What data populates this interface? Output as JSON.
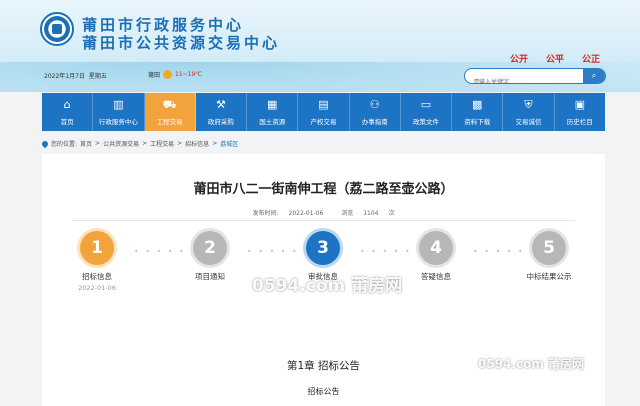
{
  "header": {
    "title_line1": "莆田市行政服务中心",
    "title_line2": "莆田市公共资源交易中心",
    "slogans": [
      "公开",
      "公平",
      "公正"
    ],
    "date": "2022年1月7日",
    "weekday": "星期五",
    "weather_city": "莆田",
    "weather_temp": "11~19℃",
    "search_placeholder": "请输入关键字",
    "colors": {
      "brand_blue": "#1d73c4",
      "accent_orange": "#f2a33c",
      "slogan_red": "#d9261c"
    }
  },
  "nav": {
    "items": [
      {
        "label": "首页",
        "icon": "home-icon",
        "glyph": "⌂"
      },
      {
        "label": "行政服务中心",
        "icon": "building-icon",
        "glyph": "▥"
      },
      {
        "label": "工程交易",
        "icon": "cart-icon",
        "glyph": "⛟"
      },
      {
        "label": "政府采购",
        "icon": "gavel-icon",
        "glyph": "⚒"
      },
      {
        "label": "国土资源",
        "icon": "land-icon",
        "glyph": "▦"
      },
      {
        "label": "产权交易",
        "icon": "document-icon",
        "glyph": "▤"
      },
      {
        "label": "办事指南",
        "icon": "people-icon",
        "glyph": "⚇"
      },
      {
        "label": "政策文件",
        "icon": "file-icon",
        "glyph": "▭"
      },
      {
        "label": "资料下载",
        "icon": "grid-icon",
        "glyph": "▩"
      },
      {
        "label": "交易诚信",
        "icon": "shield-icon",
        "glyph": "⛨"
      },
      {
        "label": "历史栏目",
        "icon": "history-icon",
        "glyph": "▣"
      }
    ],
    "active_index": 2
  },
  "breadcrumb": {
    "prefix": "您的位置:",
    "items": [
      "首页",
      "公共资源交易",
      "工程交易",
      "招标信息"
    ],
    "current": "荔城区"
  },
  "article": {
    "title": "莆田市八二一街南伸工程（荔二路至壶公路）",
    "publish_label": "发布时间:",
    "publish_date": "2022-01-06",
    "views_label": "浏览",
    "views": "1104",
    "views_unit": "次",
    "chapter": "第1章  招标公告",
    "subheading": "招标公告"
  },
  "steps": [
    {
      "num": "1",
      "label": "招标信息",
      "date": "2022-01-06",
      "state": "orange"
    },
    {
      "num": "2",
      "label": "项目通知",
      "date": "",
      "state": "gray"
    },
    {
      "num": "3",
      "label": "审批信息",
      "date": "",
      "state": "blue"
    },
    {
      "num": "4",
      "label": "答疑信息",
      "date": "",
      "state": "gray"
    },
    {
      "num": "5",
      "label": "中标结果公示",
      "date": "",
      "state": "gray"
    }
  ],
  "watermarks": [
    "0594.com 莆房网",
    "0594.com 莆房网"
  ]
}
